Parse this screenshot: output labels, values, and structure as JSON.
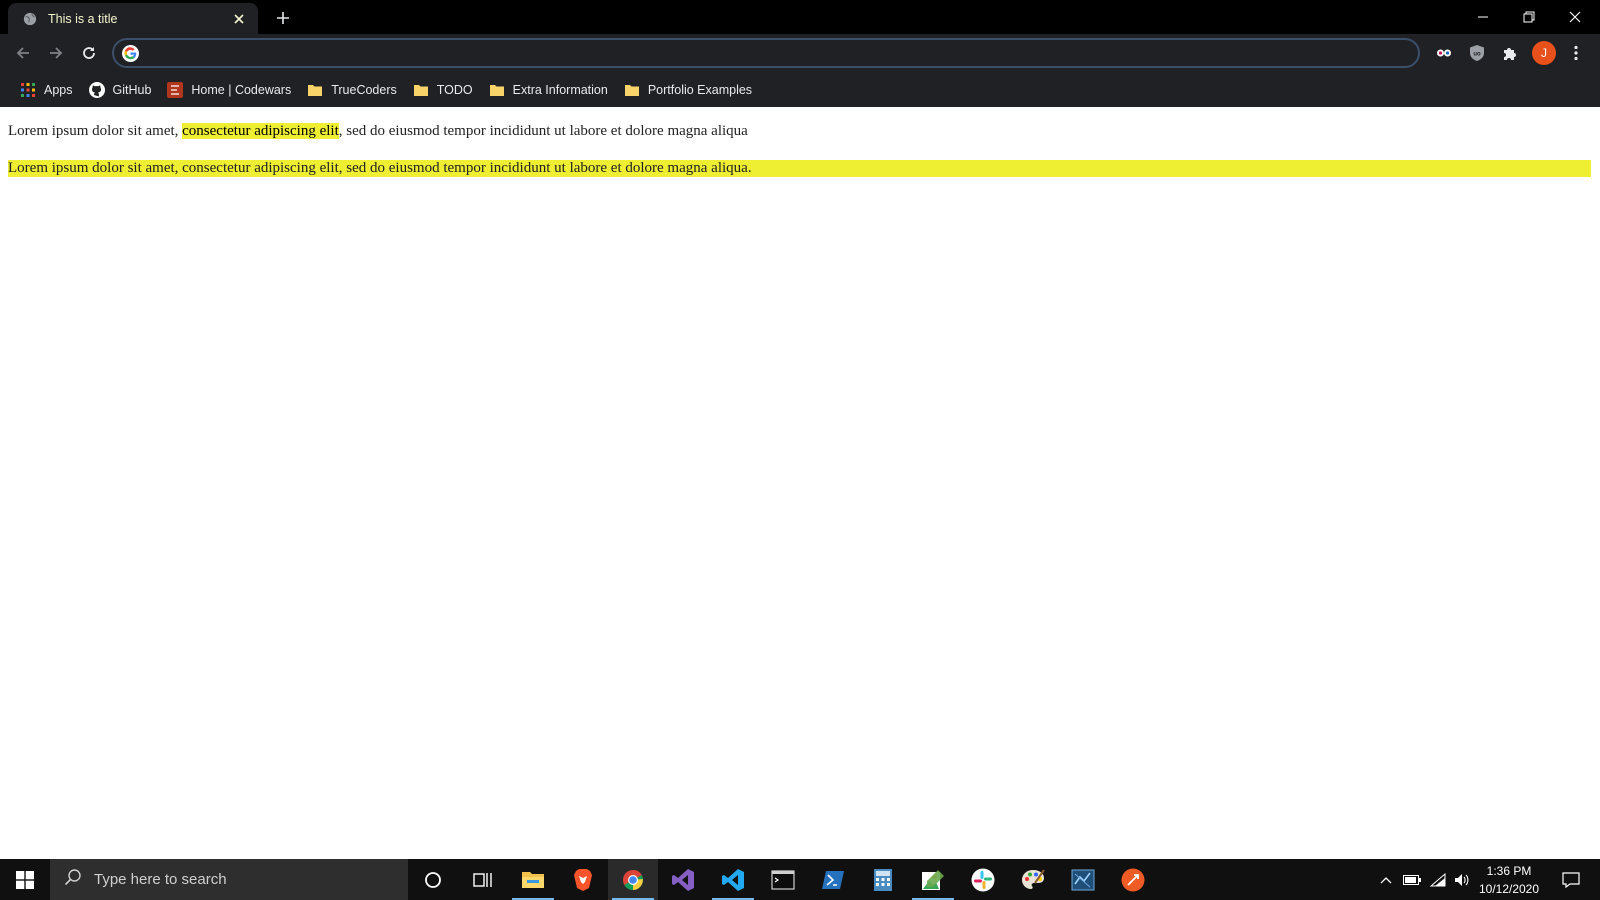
{
  "browser": {
    "tab_title": "This is a title",
    "address_value": "",
    "profile_initial": "J",
    "bookmarks": [
      {
        "label": "Apps",
        "icon": "apps-grid-icon"
      },
      {
        "label": "GitHub",
        "icon": "github-icon"
      },
      {
        "label": "Home | Codewars",
        "icon": "codewars-icon"
      },
      {
        "label": "TrueCoders",
        "icon": "folder-icon"
      },
      {
        "label": "TODO",
        "icon": "folder-icon"
      },
      {
        "label": "Extra Information",
        "icon": "folder-icon"
      },
      {
        "label": "Portfolio Examples",
        "icon": "folder-icon"
      }
    ]
  },
  "page": {
    "para1_before": "Lorem ipsum dolor sit amet, ",
    "para1_highlight": "consectetur adipiscing elit",
    "para1_after": ", sed do eiusmod tempor incididunt ut labore et dolore magna aliqua",
    "para2": "Lorem ipsum dolor sit amet, consectetur adipiscing elit, sed do eiusmod tempor incididunt ut labore et dolore magna aliqua."
  },
  "taskbar": {
    "search_placeholder": "Type here to search",
    "time": "1:36 PM",
    "date": "10/12/2020",
    "apps": [
      "cortana",
      "task-view",
      "file-explorer",
      "brave",
      "chrome",
      "visual-studio",
      "vscode",
      "terminal",
      "powershell",
      "calculator",
      "photos",
      "slack",
      "paint",
      "azure-data-studio",
      "postman"
    ]
  },
  "colors": {
    "highlight": "#eeee33",
    "browser_bg": "#202124",
    "titlebar_bg": "#000000",
    "profile_avatar": "#e8501c",
    "taskbar_bg": "#101010"
  }
}
